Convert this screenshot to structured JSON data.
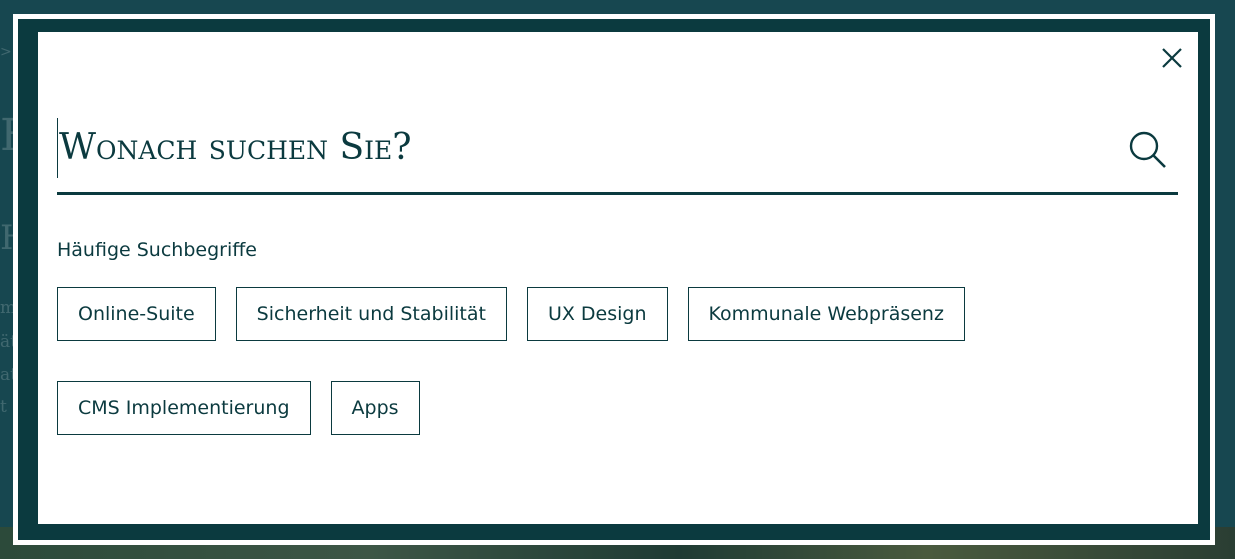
{
  "search": {
    "placeholder": "Wonach suchen Sie?",
    "value": ""
  },
  "popular": {
    "title": "Häufige Suchbegriffe",
    "terms": [
      "Online-Suite",
      "Sicherheit und Stabilität",
      "UX Design",
      "Kommunale Webpräsenz",
      "CMS Implementierung",
      "Apps"
    ]
  },
  "icons": {
    "close": "close-icon",
    "search": "search-icon"
  },
  "colors": {
    "accent": "#0b3a3f",
    "overlay": "#174750",
    "modal_background": "#ffffff"
  },
  "background": {
    "fragments": [
      ">",
      "F",
      "H",
      "me",
      "ät",
      "at",
      "t -"
    ]
  }
}
